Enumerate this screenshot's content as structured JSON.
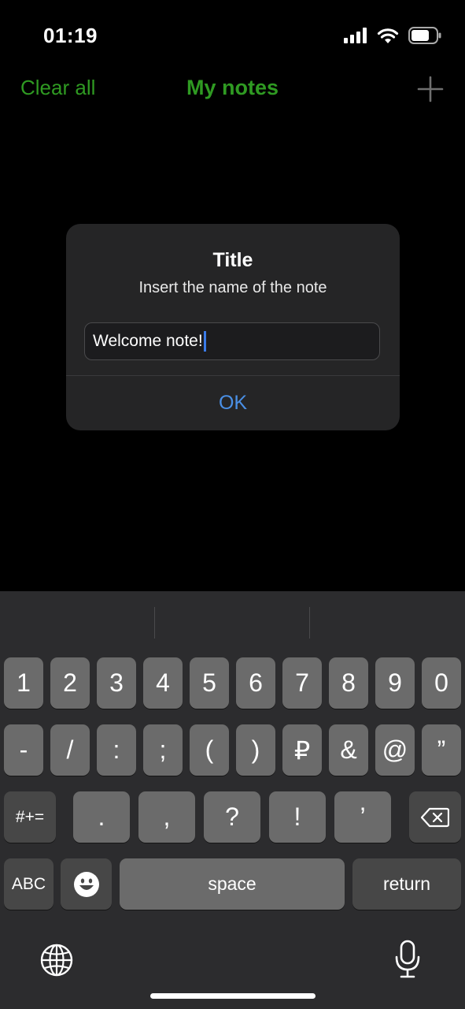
{
  "status_bar": {
    "time": "01:19",
    "icons": [
      "signal-icon",
      "wifi-icon",
      "battery-icon"
    ]
  },
  "nav": {
    "left_button": "Clear all",
    "title": "My notes",
    "right_icon": "plus-icon",
    "accent_color": "#2f9a22"
  },
  "alert": {
    "title": "Title",
    "message": "Insert the name of the note",
    "input_value": "Welcome note!",
    "ok_label": "OK",
    "button_color": "#4a90e6"
  },
  "keyboard": {
    "row1": [
      "1",
      "2",
      "3",
      "4",
      "5",
      "6",
      "7",
      "8",
      "9",
      "0"
    ],
    "row2": [
      "-",
      "/",
      ":",
      ";",
      "(",
      ")",
      "₽",
      "&",
      "@",
      "”"
    ],
    "row3": {
      "shift_label": "#+=",
      "keys": [
        ".",
        ",",
        "?",
        "!",
        "’"
      ],
      "delete_icon": "delete-icon"
    },
    "row4": {
      "abc_label": "ABC",
      "emoji_icon": "emoji-icon",
      "space_label": "space",
      "return_label": "return"
    },
    "bottom": [
      "globe-icon",
      "microphone-icon"
    ]
  }
}
